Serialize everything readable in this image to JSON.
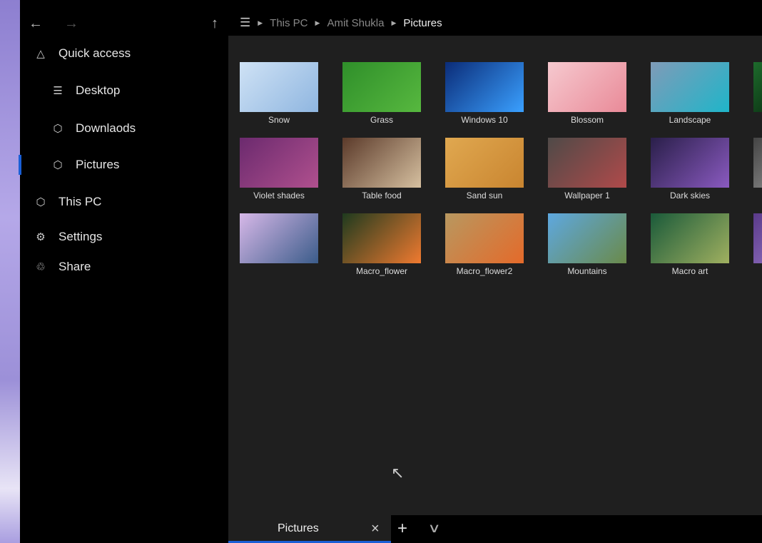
{
  "nav": {
    "back_icon": "arrow-left-icon",
    "forward_icon": "arrow-right-icon",
    "up_icon": "arrow-up-icon"
  },
  "breadcrumb": {
    "root_icon": "layers-icon",
    "items": [
      "This PC",
      "Amit Shukla",
      "Pictures"
    ]
  },
  "sidebar": {
    "items": [
      {
        "label": "Quick access",
        "icon": "pin-icon"
      },
      {
        "label": "Desktop",
        "icon": "layers-icon"
      },
      {
        "label": "Downlaods",
        "icon": "cube-icon"
      },
      {
        "label": "Pictures",
        "icon": "cube-icon",
        "selected": true
      },
      {
        "label": "This PC",
        "icon": "cube-icon"
      },
      {
        "label": "Settings",
        "icon": "gear-icon"
      },
      {
        "label": "Share",
        "icon": "share-icon"
      }
    ]
  },
  "files": [
    {
      "name": "Snow",
      "colors": [
        "#cfe2f5",
        "#8fb6e0"
      ]
    },
    {
      "name": "Grass",
      "colors": [
        "#2f8f2a",
        "#57b83f"
      ]
    },
    {
      "name": "Windows 10",
      "colors": [
        "#0b2c78",
        "#3aa0ff"
      ]
    },
    {
      "name": "Blossom",
      "colors": [
        "#f6c9cf",
        "#e98a98"
      ]
    },
    {
      "name": "Landscape",
      "colors": [
        "#7f9bb8",
        "#1fb5c9"
      ]
    },
    {
      "name": "",
      "colors": [
        "#1d6b2c",
        "#0f3d18"
      ]
    },
    {
      "name": "Violet shades",
      "colors": [
        "#6b2a6e",
        "#b0508e"
      ]
    },
    {
      "name": "Table food",
      "colors": [
        "#5b3a2a",
        "#d6c0a0"
      ]
    },
    {
      "name": "Sand sun",
      "colors": [
        "#e0a850",
        "#c98530"
      ]
    },
    {
      "name": "Wallpaper 1",
      "colors": [
        "#4f4a48",
        "#b04a4a"
      ]
    },
    {
      "name": "Dark skies",
      "colors": [
        "#2a1f4a",
        "#8a5ac0"
      ]
    },
    {
      "name": "",
      "colors": [
        "#444",
        "#777"
      ]
    },
    {
      "name": "",
      "colors": [
        "#d7b8e8",
        "#3b5c8a"
      ]
    },
    {
      "name": "Macro_flower",
      "colors": [
        "#1e3a1e",
        "#f07a30"
      ]
    },
    {
      "name": "Macro_flower2",
      "colors": [
        "#b89860",
        "#e46a2a"
      ]
    },
    {
      "name": "Mountains",
      "colors": [
        "#5ea8e0",
        "#6a8a4a"
      ]
    },
    {
      "name": "Macro art",
      "colors": [
        "#1a5a3a",
        "#a0b060"
      ]
    },
    {
      "name": "",
      "colors": [
        "#5a3a8a",
        "#8060b0"
      ]
    }
  ],
  "tabs": [
    {
      "label": "Pictures",
      "active": true
    }
  ],
  "tabbar": {
    "close_icon": "close-icon",
    "new_tab_icon": "plus-icon",
    "dropdown_icon": "chevron-down-icon"
  },
  "colors": {
    "accent": "#1a5fd6",
    "content_bg": "#1f1f1f"
  }
}
